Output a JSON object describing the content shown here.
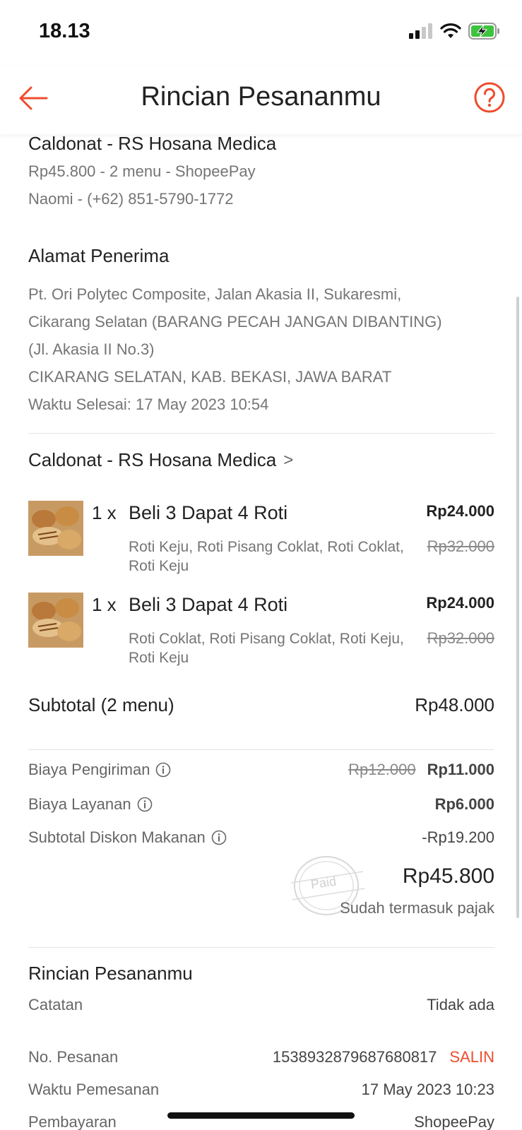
{
  "status": {
    "time": "18.13"
  },
  "header": {
    "title": "Rincian Pesananmu"
  },
  "order_summary": {
    "store": "Caldonat - RS Hosana Medica",
    "price_line": "Rp45.800 - 2 menu  - ShopeePay",
    "contact": "Naomi - (+62) 851-5790-1772"
  },
  "address": {
    "heading": "Alamat Penerima",
    "line1": "Pt. Ori Polytec Composite, Jalan Akasia II, Sukaresmi,",
    "line2": "Cikarang Selatan (BARANG PECAH JANGAN DIBANTING)",
    "line3": "(Jl. Akasia II No.3)",
    "line4": "CIKARANG SELATAN, KAB. BEKASI, JAWA BARAT",
    "finished": "Waktu Selesai: 17 May 2023 10:54"
  },
  "store_link": {
    "name": "Caldonat - RS Hosana Medica",
    "chevron": ">"
  },
  "items": [
    {
      "qty": "1 x",
      "name": "Beli 3 Dapat 4 Roti",
      "desc": "Roti Keju, Roti Pisang Coklat, Roti Coklat, Roti Keju",
      "price": "Rp24.000",
      "old_price": "Rp32.000"
    },
    {
      "qty": "1 x",
      "name": "Beli 3 Dapat 4 Roti",
      "desc": "Roti Coklat, Roti Pisang Coklat, Roti Keju, Roti Keju",
      "price": "Rp24.000",
      "old_price": "Rp32.000"
    }
  ],
  "subtotal": {
    "label": "Subtotal (2 menu)",
    "value": "Rp48.000"
  },
  "fees": {
    "shipping_label": "Biaya Pengiriman",
    "shipping_old": "Rp12.000",
    "shipping_value": "Rp11.000",
    "service_label": "Biaya Layanan",
    "service_value": "Rp6.000",
    "discount_label": "Subtotal Diskon Makanan",
    "discount_value": "-Rp19.200"
  },
  "total": {
    "value": "Rp45.800",
    "tax_note": "Sudah termasuk pajak",
    "stamp": "Paid"
  },
  "details": {
    "heading": "Rincian Pesananmu",
    "note_label": "Catatan",
    "note_value": "Tidak ada",
    "order_no_label": "No. Pesanan",
    "order_no_value": "1538932879687680817",
    "copy_label": "SALIN",
    "order_time_label": "Waktu Pemesanan",
    "order_time_value": "17 May 2023 10:23",
    "payment_label": "Pembayaran",
    "payment_value": "ShopeePay"
  },
  "colors": {
    "accent": "#ee4d2d",
    "text": "#222222",
    "muted": "#757575"
  }
}
